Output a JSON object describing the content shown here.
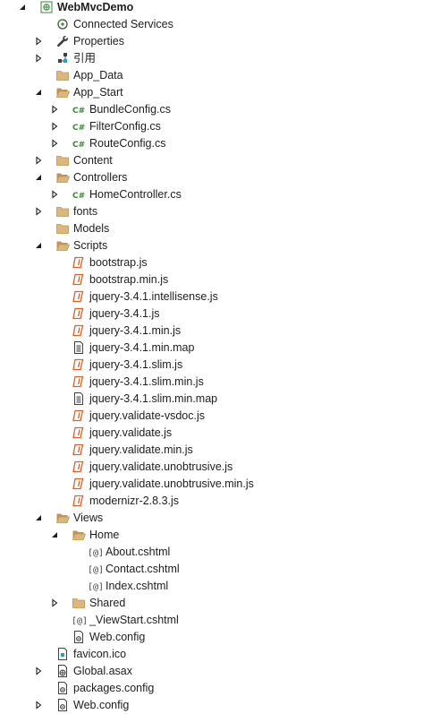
{
  "solution_explorer": {
    "items": [
      {
        "label": "WebMvcDemo",
        "level": 0,
        "chevron": "expanded",
        "icon": "web-project-icon",
        "root": true
      },
      {
        "label": "Connected Services",
        "level": 1,
        "chevron": "none",
        "icon": "connected-services-icon"
      },
      {
        "label": "Properties",
        "level": 1,
        "chevron": "collapsed",
        "icon": "wrench-icon"
      },
      {
        "label": "引用",
        "level": 1,
        "chevron": "collapsed",
        "icon": "references-icon"
      },
      {
        "label": "App_Data",
        "level": 1,
        "chevron": "none",
        "icon": "folder-icon"
      },
      {
        "label": "App_Start",
        "level": 1,
        "chevron": "expanded",
        "icon": "folder-open-icon"
      },
      {
        "label": "BundleConfig.cs",
        "level": 2,
        "chevron": "collapsed",
        "icon": "csharp-file-icon"
      },
      {
        "label": "FilterConfig.cs",
        "level": 2,
        "chevron": "collapsed",
        "icon": "csharp-file-icon"
      },
      {
        "label": "RouteConfig.cs",
        "level": 2,
        "chevron": "collapsed",
        "icon": "csharp-file-icon"
      },
      {
        "label": "Content",
        "level": 1,
        "chevron": "collapsed",
        "icon": "folder-icon"
      },
      {
        "label": "Controllers",
        "level": 1,
        "chevron": "expanded",
        "icon": "folder-open-icon"
      },
      {
        "label": "HomeController.cs",
        "level": 2,
        "chevron": "collapsed",
        "icon": "csharp-file-icon"
      },
      {
        "label": "fonts",
        "level": 1,
        "chevron": "collapsed",
        "icon": "folder-icon"
      },
      {
        "label": "Models",
        "level": 1,
        "chevron": "none",
        "icon": "folder-icon"
      },
      {
        "label": "Scripts",
        "level": 1,
        "chevron": "expanded",
        "icon": "folder-open-icon"
      },
      {
        "label": "bootstrap.js",
        "level": 2,
        "chevron": "none",
        "icon": "js-file-icon"
      },
      {
        "label": "bootstrap.min.js",
        "level": 2,
        "chevron": "none",
        "icon": "js-file-icon"
      },
      {
        "label": "jquery-3.4.1.intellisense.js",
        "level": 2,
        "chevron": "none",
        "icon": "js-file-icon"
      },
      {
        "label": "jquery-3.4.1.js",
        "level": 2,
        "chevron": "none",
        "icon": "js-file-icon"
      },
      {
        "label": "jquery-3.4.1.min.js",
        "level": 2,
        "chevron": "none",
        "icon": "js-file-icon"
      },
      {
        "label": "jquery-3.4.1.min.map",
        "level": 2,
        "chevron": "none",
        "icon": "text-file-icon"
      },
      {
        "label": "jquery-3.4.1.slim.js",
        "level": 2,
        "chevron": "none",
        "icon": "js-file-icon"
      },
      {
        "label": "jquery-3.4.1.slim.min.js",
        "level": 2,
        "chevron": "none",
        "icon": "js-file-icon"
      },
      {
        "label": "jquery-3.4.1.slim.min.map",
        "level": 2,
        "chevron": "none",
        "icon": "text-file-icon"
      },
      {
        "label": "jquery.validate-vsdoc.js",
        "level": 2,
        "chevron": "none",
        "icon": "js-file-icon"
      },
      {
        "label": "jquery.validate.js",
        "level": 2,
        "chevron": "none",
        "icon": "js-file-icon"
      },
      {
        "label": "jquery.validate.min.js",
        "level": 2,
        "chevron": "none",
        "icon": "js-file-icon"
      },
      {
        "label": "jquery.validate.unobtrusive.js",
        "level": 2,
        "chevron": "none",
        "icon": "js-file-icon"
      },
      {
        "label": "jquery.validate.unobtrusive.min.js",
        "level": 2,
        "chevron": "none",
        "icon": "js-file-icon"
      },
      {
        "label": "modernizr-2.8.3.js",
        "level": 2,
        "chevron": "none",
        "icon": "js-file-icon"
      },
      {
        "label": "Views",
        "level": 1,
        "chevron": "expanded",
        "icon": "folder-open-icon"
      },
      {
        "label": "Home",
        "level": 2,
        "chevron": "expanded",
        "icon": "folder-open-icon"
      },
      {
        "label": "About.cshtml",
        "level": 3,
        "chevron": "none",
        "icon": "razor-file-icon"
      },
      {
        "label": "Contact.cshtml",
        "level": 3,
        "chevron": "none",
        "icon": "razor-file-icon"
      },
      {
        "label": "Index.cshtml",
        "level": 3,
        "chevron": "none",
        "icon": "razor-file-icon"
      },
      {
        "label": "Shared",
        "level": 2,
        "chevron": "collapsed",
        "icon": "folder-icon"
      },
      {
        "label": "_ViewStart.cshtml",
        "level": 2,
        "chevron": "none",
        "icon": "razor-file-icon"
      },
      {
        "label": "Web.config",
        "level": 2,
        "chevron": "none",
        "icon": "config-file-icon"
      },
      {
        "label": "favicon.ico",
        "level": 1,
        "chevron": "none",
        "icon": "ico-file-icon"
      },
      {
        "label": "Global.asax",
        "level": 1,
        "chevron": "collapsed",
        "icon": "global-asax-icon"
      },
      {
        "label": "packages.config",
        "level": 1,
        "chevron": "none",
        "icon": "config-file-icon"
      },
      {
        "label": "Web.config",
        "level": 1,
        "chevron": "collapsed",
        "icon": "config-file-icon"
      }
    ]
  },
  "colors": {
    "text": "#1e1e1e",
    "folder": "#dcb67a",
    "csharp": "#388a34",
    "js": "#d8642a",
    "chevron": "#1e1e1e"
  }
}
